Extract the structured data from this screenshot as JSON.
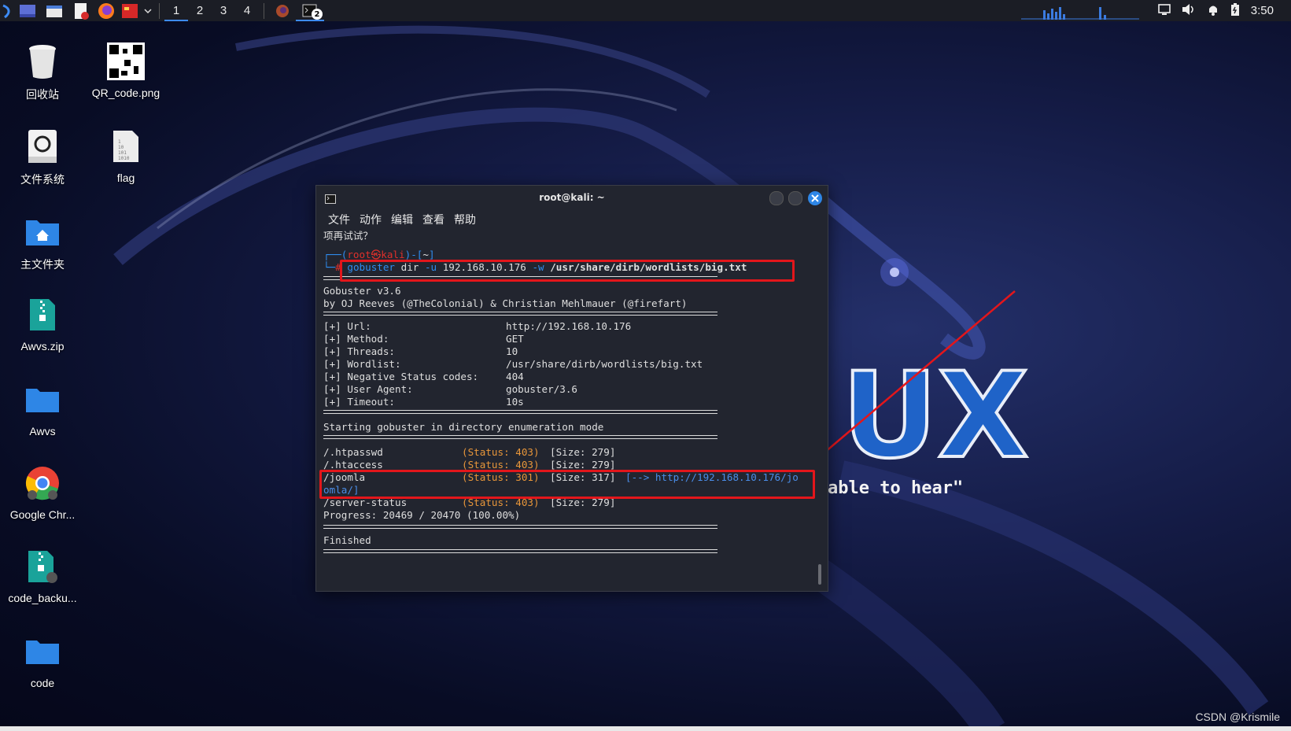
{
  "taskbar": {
    "workspaces": [
      "1",
      "2",
      "3",
      "4"
    ],
    "terminal_badge": "2",
    "clock": "3:50"
  },
  "desktop": {
    "icons": [
      {
        "label": "回收站",
        "icon": "trash-icon"
      },
      {
        "label": "QR_code.png",
        "icon": "qr-code-icon"
      },
      {
        "label": "文件系统",
        "icon": "drive-icon"
      },
      {
        "label": "flag",
        "icon": "binary-file-icon"
      },
      {
        "label": "主文件夹",
        "icon": "home-folder-icon"
      },
      {
        "label": "Awvs.zip",
        "icon": "zip-file-icon"
      },
      {
        "label": "Awvs",
        "icon": "folder-icon"
      },
      {
        "label": "Google Chr...",
        "icon": "chrome-icon"
      },
      {
        "label": "code_backu...",
        "icon": "zip-file-icon"
      },
      {
        "label": "code",
        "icon": "folder-icon"
      }
    ]
  },
  "terminal": {
    "title": "root@kali: ~",
    "menu": [
      "文件",
      "动作",
      "编辑",
      "查看",
      "帮助"
    ],
    "retry_prompt": "项再试试？",
    "prompt_user": "root㉿kali",
    "prompt_dir": "~",
    "cmd_name": "gobuster",
    "cmd_args_plain": " dir ",
    "cmd_flag_u": "-u",
    "cmd_target": " 192.168.10.176 ",
    "cmd_flag_w": "-w",
    "cmd_wordlist": " /usr/share/dirb/wordlists/big.txt",
    "banner_version": "Gobuster v3.6",
    "banner_author": "by OJ Reeves (@TheColonial) & Christian Mehlmauer (@firefart)",
    "config": [
      {
        "key": "[+] Url:",
        "value": "http://192.168.10.176"
      },
      {
        "key": "[+] Method:",
        "value": "GET"
      },
      {
        "key": "[+] Threads:",
        "value": "10"
      },
      {
        "key": "[+] Wordlist:",
        "value": "/usr/share/dirb/wordlists/big.txt"
      },
      {
        "key": "[+] Negative Status codes:",
        "value": "404"
      },
      {
        "key": "[+] User Agent:",
        "value": "gobuster/3.6"
      },
      {
        "key": "[+] Timeout:",
        "value": "10s"
      }
    ],
    "mode_line": "Starting gobuster in directory enumeration mode",
    "results": [
      {
        "path": "/.htpasswd",
        "status": "(Status: 403)",
        "size": "[Size: 279]"
      },
      {
        "path": "/.htaccess",
        "status": "(Status: 403)",
        "size": "[Size: 279]"
      },
      {
        "path": "/joomla",
        "status": "(Status: 301)",
        "size": "[Size: 317]",
        "redirect_a": "[--> http://192.168.10.176/jo",
        "redirect_b": "omla/]"
      },
      {
        "path": "/server-status",
        "status": "(Status: 403)",
        "size": "[Size: 279]"
      }
    ],
    "progress": "Progress: 20469 / 20470 (100.00%)",
    "finished": "Finished"
  },
  "wallpaper": {
    "tagline_fragment": "able to hear\""
  },
  "watermark": "CSDN @Krismile"
}
